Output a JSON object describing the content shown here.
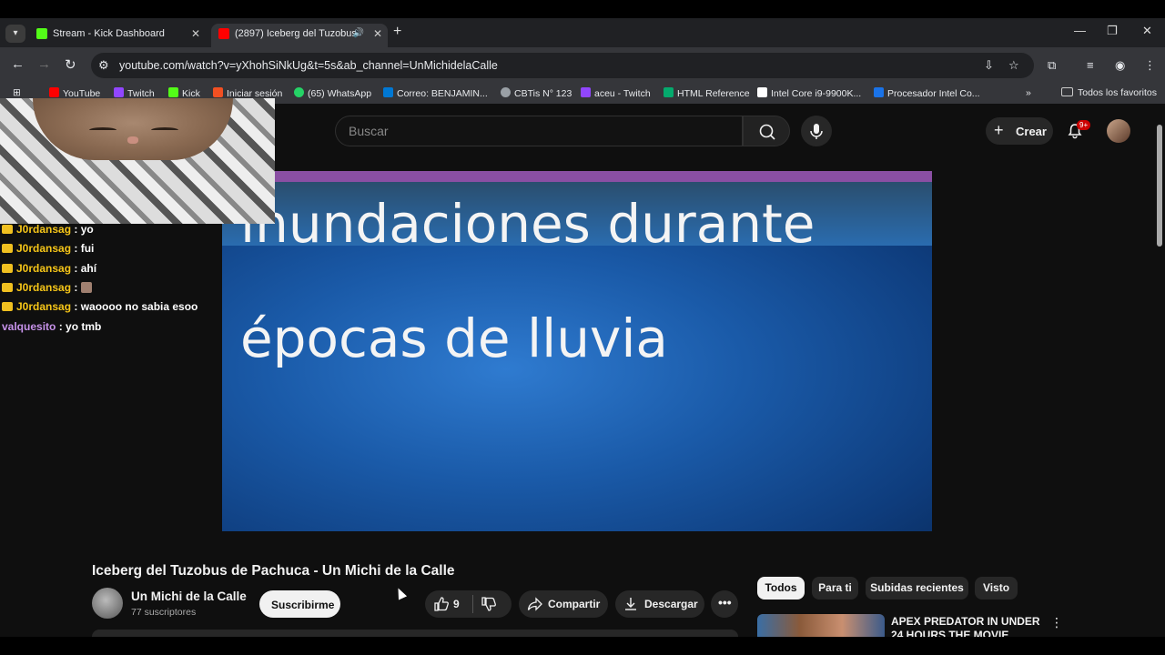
{
  "browser": {
    "tabs": [
      {
        "title": "Stream - Kick Dashboard",
        "favicon_color": "#53fc18"
      },
      {
        "title": "(2897) Iceberg del Tuzobus",
        "favicon_color": "#ff0000"
      }
    ],
    "url": "youtube.com/watch?v=yXhohSiNkUg&t=5s&ab_channel=UnMichidelaCalle",
    "bookmarks": [
      {
        "label": "YouTube",
        "color": "#ff0000"
      },
      {
        "label": "Twitch",
        "color": "#9146ff"
      },
      {
        "label": "Kick",
        "color": "#53fc18"
      },
      {
        "label": "Iniciar sesión",
        "color": "#f25022"
      },
      {
        "label": "(65) WhatsApp",
        "color": "#25d366"
      },
      {
        "label": "Correo: BENJAMIN...",
        "color": "#0078d4"
      },
      {
        "label": "CBTis N° 123",
        "color": "#9aa0a6"
      },
      {
        "label": "aceu - Twitch",
        "color": "#9146ff"
      },
      {
        "label": "HTML Reference",
        "color": "#04aa6d"
      },
      {
        "label": "Intel Core i9-9900K...",
        "color": "#ffffff"
      },
      {
        "label": "Procesador Intel Co...",
        "color": "#1a73e8"
      }
    ],
    "all_bookmarks": "Todos los favoritos"
  },
  "youtube": {
    "search_placeholder": "Buscar",
    "create_label": "Crear",
    "notifications_badge": "9+",
    "video_text_line1": "inundaciones durante",
    "video_text_line2": "épocas de lluvia",
    "title": "Iceberg del Tuzobus de Pachuca - Un Michi de la Calle",
    "channel_name": "Un Michi de la Calle",
    "subscribers": "77 suscriptores",
    "subscribe_label": "Suscribirme",
    "likes": "9",
    "share_label": "Compartir",
    "download_label": "Descargar",
    "chips": [
      "Todos",
      "Para ti",
      "Subidas recientes",
      "Visto"
    ],
    "recommended_title": "APEX PREDATOR IN UNDER 24 HOURS THE MOVIE"
  },
  "chat": [
    {
      "user": "J0rdansag",
      "message": "yo"
    },
    {
      "user": "J0rdansag",
      "message": "fui"
    },
    {
      "user": "J0rdansag",
      "message": "ahí"
    },
    {
      "user": "J0rdansag",
      "message": ""
    },
    {
      "user": "J0rdansag",
      "message": "waoooo no sabia esoo"
    },
    {
      "user": "valquesito",
      "message": "yo tmb"
    }
  ]
}
